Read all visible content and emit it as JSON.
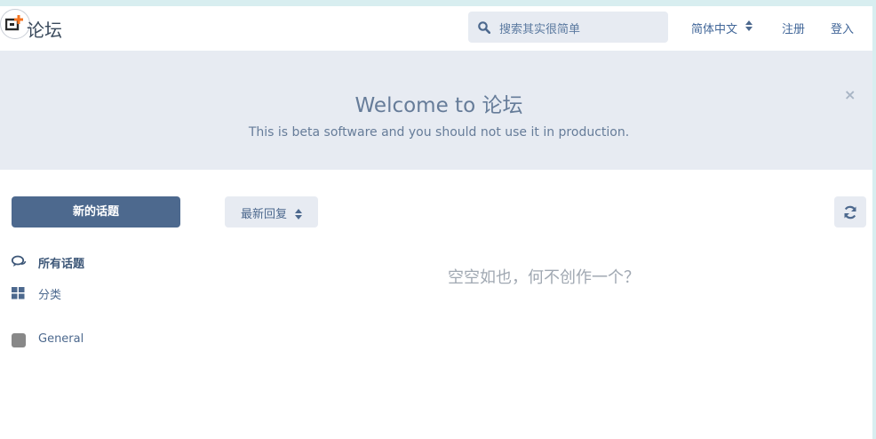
{
  "header": {
    "site_title": "论坛",
    "search_placeholder": "搜索其实很简单",
    "language": "简体中文",
    "register": "注册",
    "login": "登入"
  },
  "hero": {
    "title": "Welcome to 论坛",
    "subtitle": "This is beta software and you should not use it in production.",
    "close": "×"
  },
  "sidebar": {
    "new_topic": "新的话题",
    "items": [
      {
        "label": "所有话题",
        "icon": "comments-icon",
        "active": true
      },
      {
        "label": "分类",
        "icon": "grid-icon",
        "active": false
      }
    ],
    "tags": [
      {
        "label": "General",
        "color": "#888888"
      }
    ]
  },
  "main": {
    "sort_label": "最新回复",
    "empty_text": "空空如也，何不创作一个？"
  },
  "colors": {
    "accent": "#4d698e",
    "hero_bg": "#e7ebf2",
    "link": "#426799"
  }
}
